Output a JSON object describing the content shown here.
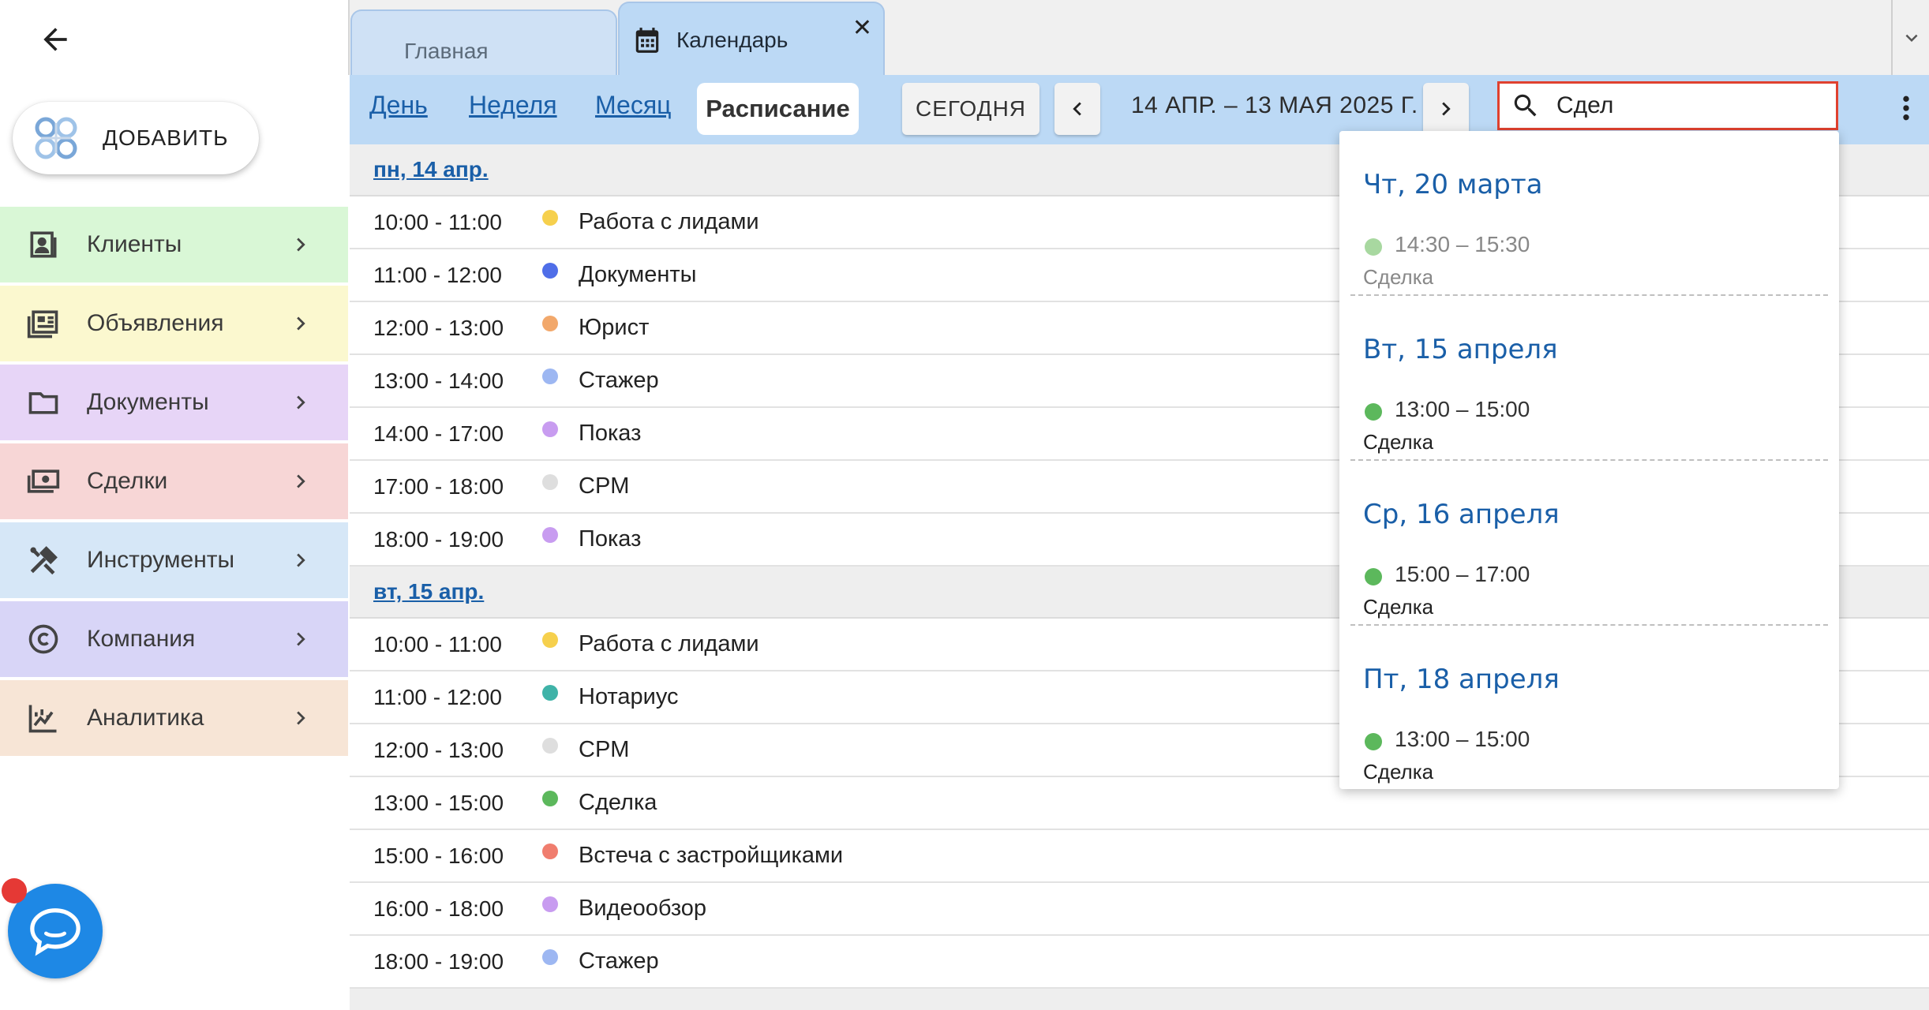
{
  "sidebar": {
    "add_label": "ДОБАВИТЬ",
    "items": [
      {
        "label": "Клиенты",
        "color": "#d9f7d6",
        "icon": "contacts-icon"
      },
      {
        "label": "Объявления",
        "color": "#fbf8cf",
        "icon": "listings-icon"
      },
      {
        "label": "Документы",
        "color": "#e7d5f7",
        "icon": "folder-icon"
      },
      {
        "label": "Сделки",
        "color": "#f7d6d6",
        "icon": "money-icon"
      },
      {
        "label": "Инструменты",
        "color": "#d6e7f7",
        "icon": "tools-icon"
      },
      {
        "label": "Компания",
        "color": "#d8d5f7",
        "icon": "copyright-icon"
      },
      {
        "label": "Аналитика",
        "color": "#f7e5d6",
        "icon": "analytics-icon"
      }
    ]
  },
  "tabs": [
    {
      "label": "Главная"
    },
    {
      "label": "Календарь"
    }
  ],
  "toolbar": {
    "views": [
      "День",
      "Неделя",
      "Месяц",
      "Расписание"
    ],
    "today_label": "СЕГОДНЯ",
    "range": "14 АПР. – 13 МАЯ 2025 Г."
  },
  "search": {
    "value": "Сдел"
  },
  "schedule": [
    {
      "day": "пн, 14 апр.",
      "events": [
        {
          "time": "10:00 - 11:00",
          "title": "Работа с лидами",
          "color": "#f6d04d"
        },
        {
          "time": "11:00 - 12:00",
          "title": "Документы",
          "color": "#4f6ee8"
        },
        {
          "time": "12:00 - 13:00",
          "title": "Юрист",
          "color": "#f2a86b"
        },
        {
          "time": "13:00 - 14:00",
          "title": "Стажер",
          "color": "#9db7f2"
        },
        {
          "time": "14:00 - 17:00",
          "title": "Показ",
          "color": "#c89cf0"
        },
        {
          "time": "17:00 - 18:00",
          "title": "CPM",
          "color": "#dedede"
        },
        {
          "time": "18:00 - 19:00",
          "title": "Показ",
          "color": "#c89cf0"
        }
      ]
    },
    {
      "day": "вт, 15 апр.",
      "events": [
        {
          "time": "10:00 - 11:00",
          "title": "Работа с лидами",
          "color": "#f6d04d"
        },
        {
          "time": "11:00 - 12:00",
          "title": "Нотариус",
          "color": "#3fb3a8"
        },
        {
          "time": "12:00 - 13:00",
          "title": "CPM",
          "color": "#dedede"
        },
        {
          "time": "13:00 - 15:00",
          "title": "Сделка",
          "color": "#5cb85c"
        },
        {
          "time": "15:00 - 16:00",
          "title": "Встеча с застройщиками",
          "color": "#f07d6e"
        },
        {
          "time": "16:00 - 18:00",
          "title": "Видеообзор",
          "color": "#c89cf0"
        },
        {
          "time": "18:00 - 19:00",
          "title": "Стажер",
          "color": "#9db7f2"
        }
      ]
    }
  ],
  "search_results": [
    {
      "date": "Чт, 20 марта",
      "time": "14:30 – 15:30",
      "title": "Сделка",
      "color": "#a8d8a0",
      "past": true
    },
    {
      "date": "Вт, 15 апреля",
      "time": "13:00 – 15:00",
      "title": "Сделка",
      "color": "#5cb85c",
      "past": false
    },
    {
      "date": "Ср, 16 апреля",
      "time": "15:00 – 17:00",
      "title": "Сделка",
      "color": "#5cb85c",
      "past": false
    },
    {
      "date": "Пт, 18 апреля",
      "time": "13:00 – 15:00",
      "title": "Сделка",
      "color": "#5cb85c",
      "past": false
    }
  ]
}
